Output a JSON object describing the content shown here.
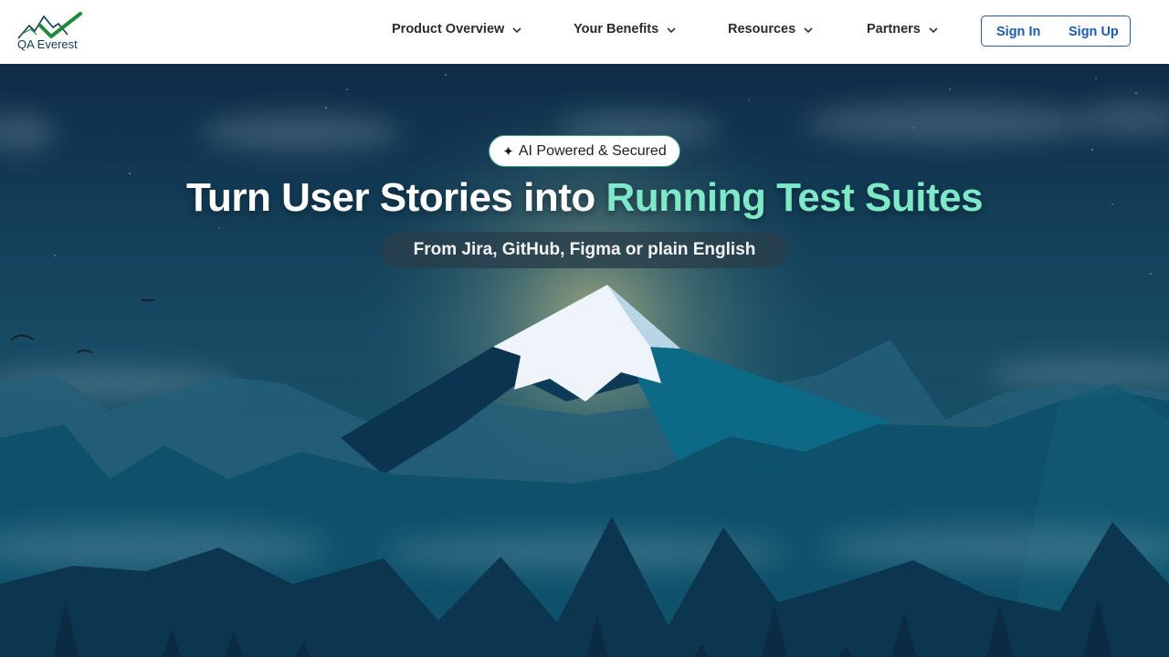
{
  "brand": {
    "name": "QA Everest",
    "logo_icon": "mountain-check-icon",
    "logo_color": "#1f8a3a"
  },
  "nav": {
    "items": [
      {
        "label": "Product Overview",
        "icon": "chevron-down-icon"
      },
      {
        "label": "Your Benefits",
        "icon": "chevron-down-icon"
      },
      {
        "label": "Resources",
        "icon": "chevron-down-icon"
      },
      {
        "label": "Partners",
        "icon": "chevron-down-icon"
      }
    ],
    "sign_in": "Sign In",
    "sign_up": "Sign Up",
    "auth_color": "#1f5fae"
  },
  "hero": {
    "badge_icon": "sparkle-icon",
    "badge": "AI Powered & Secured",
    "headline_main": "Turn User Stories into ",
    "headline_accent": "Running Test Suites",
    "accent_color": "#7ee8c9",
    "subheadline": "From Jira, GitHub, Figma or plain English"
  }
}
